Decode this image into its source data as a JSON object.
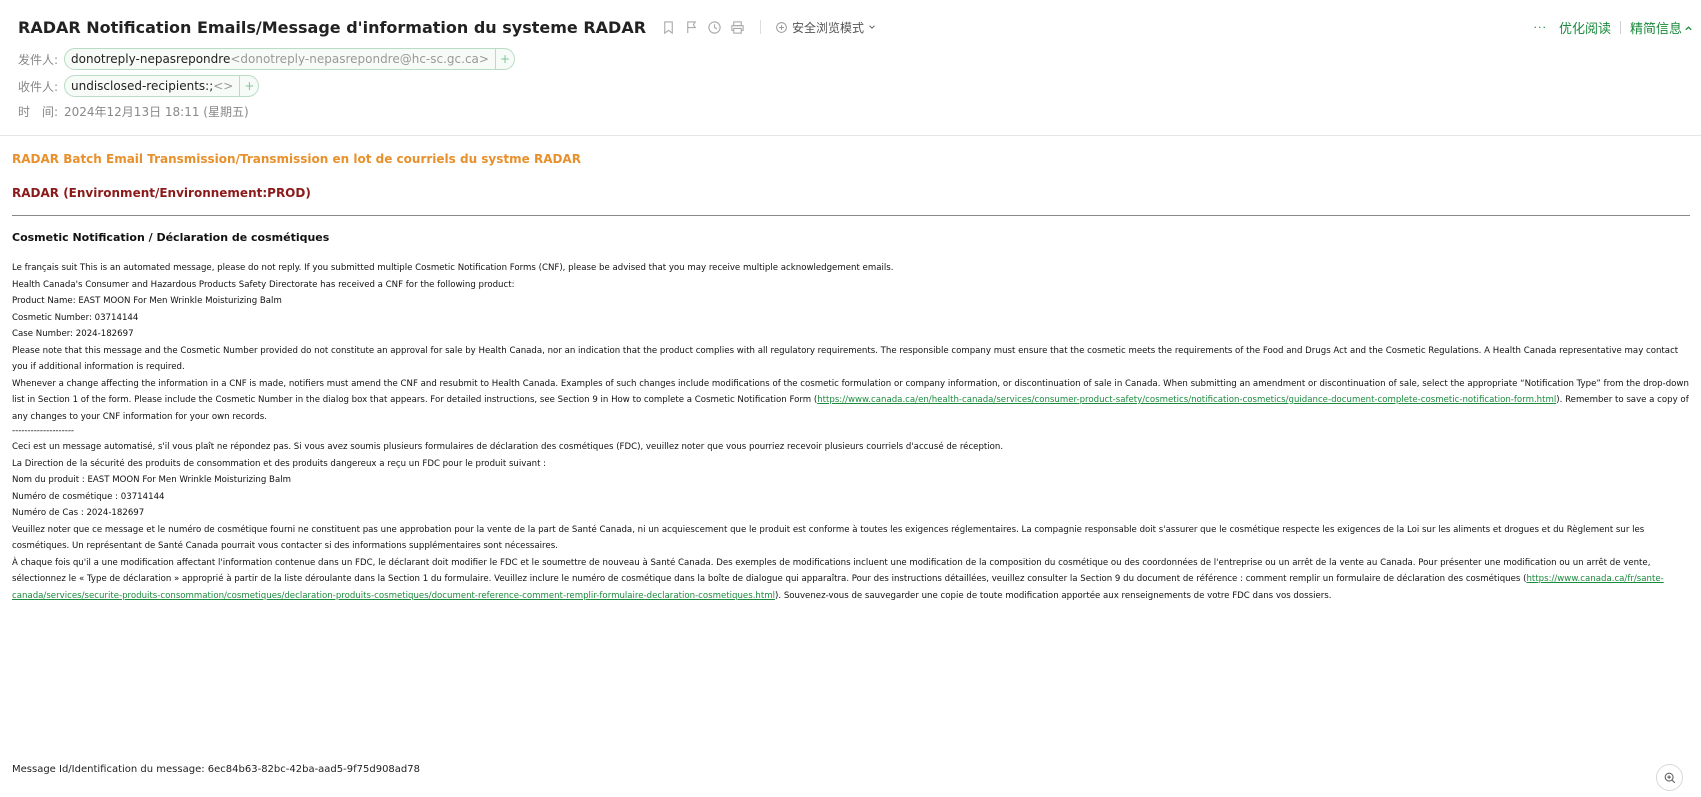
{
  "header": {
    "subject": "RADAR Notification Emails/Message d'information du systeme RADAR",
    "safe_mode_label": "安全浏览模式",
    "dots": "···",
    "optimize_read": "优化阅读",
    "brief_info": "精简信息",
    "from_label": "发件人:",
    "from_name": "donotreply-nepasrepondre",
    "from_addr": "<donotreply-nepasrepondre@hc-sc.gc.ca>",
    "to_label": "收件人:",
    "to_name": "undisclosed-recipients:;",
    "to_addr": "<>",
    "time_label": "时　间:",
    "time_value": "2024年12月13日 18:11 (星期五)",
    "add_symbol": "+"
  },
  "body": {
    "title": "RADAR Batch Email Transmission/Transmission en lot de courriels du systme RADAR",
    "environment": "RADAR (Environment/Environnement:PROD)",
    "section_title": "Cosmetic Notification / Déclaration de cosmétiques",
    "en": {
      "line1": "Le français suit This is an automated message, please do not reply. If you submitted multiple Cosmetic Notification Forms (CNF), please be advised that you may receive multiple acknowledgement emails.",
      "line2": "Health Canada's Consumer and Hazardous Products Safety Directorate has received a CNF for the following product:",
      "product": "Product Name: EAST MOON For Men Wrinkle Moisturizing Balm",
      "cosmetic_number": "Cosmetic Number: 03714144",
      "case_number": "Case Number: 2024-182697",
      "note": "Please note that this message and the Cosmetic Number provided do not constitute an approval for sale by Health Canada, nor an indication that the product complies with all regulatory requirements. The responsible company must ensure that the cosmetic meets the requirements of the Food and Drugs Act and the Cosmetic Regulations. A Health Canada representative may contact you if additional information is required.",
      "change_before": "Whenever a change affecting the information in a CNF is made, notifiers must amend the CNF and resubmit to Health Canada. Examples of such changes include modifications of the cosmetic formulation or company information, or discontinuation of sale in Canada. When submitting an amendment or discontinuation of sale, select the appropriate “Notification Type” from the drop-down list in Section 1 of the form. Please include the Cosmetic Number in the dialog box that appears. For detailed instructions, see Section 9 in How to complete a Cosmetic Notification Form (",
      "change_link": "https://www.canada.ca/en/health-canada/services/consumer-product-safety/cosmetics/notification-cosmetics/guidance-document-complete-cosmetic-notification-form.html",
      "change_after": "). Remember to save a copy of any changes to your CNF information for your own records."
    },
    "divider": "--------------------",
    "fr": {
      "line1": "Ceci est un message automatisé, s'il vous plaît ne répondez pas. Si vous avez soumis plusieurs formulaires de déclaration des cosmétiques (FDC), veuillez noter que vous pourriez recevoir plusieurs courriels d'accusé de réception.",
      "line2": "La Direction de la sécurité des produits de consommation et des produits dangereux a reçu un FDC pour le produit suivant :",
      "product": "Nom du produit : EAST MOON For Men Wrinkle Moisturizing Balm",
      "cosmetic_number": "Numéro de cosmétique : 03714144",
      "case_number": "Numéro de Cas : 2024-182697",
      "note": "Veuillez noter que ce message et le numéro de cosmétique fourni ne constituent pas une approbation pour la vente de la part de Santé Canada, ni un acquiescement que le produit est conforme à toutes les exigences réglementaires. La compagnie responsable doit s'assurer que le cosmétique respecte les exigences de la Loi sur les aliments et drogues et du Règlement sur les cosmétiques. Un représentant de Santé Canada pourrait vous contacter si des informations supplémentaires sont nécessaires.",
      "change_before": "À chaque fois qu'il a une modification affectant l'information contenue dans un FDC, le déclarant doit modifier le FDC et le soumettre de nouveau à Santé Canada. Des exemples de modifications incluent une modification de la composition du cosmétique ou des coordonnées de l'entreprise ou un arrêt de la vente au Canada. Pour présenter une modification ou un arrêt de vente, sélectionnez le « Type de déclaration » approprié à partir de la liste déroulante dans la Section 1 du formulaire. Veuillez inclure le numéro de cosmétique dans la boîte de dialogue qui apparaîtra. Pour des instructions détaillées, veuillez consulter la Section 9 du document de référence : comment remplir un formulaire de déclaration des cosmétiques (",
      "change_link": "https://www.canada.ca/fr/sante-canada/services/securite-produits-consommation/cosmetiques/declaration-produits-cosmetiques/document-reference-comment-remplir-formulaire-declaration-cosmetiques.html",
      "change_after": "). Souvenez-vous de sauvegarder une copie de toute modification apportée aux renseignements de votre FDC dans vos dossiers."
    },
    "message_id": "Message Id/Identification du message: 6ec84b63-82bc-42ba-aad5-9f75d908ad78"
  },
  "colors": {
    "accent_green": "#1a8a3c",
    "title_orange": "#e8902c",
    "env_red": "#8b1a1a"
  }
}
